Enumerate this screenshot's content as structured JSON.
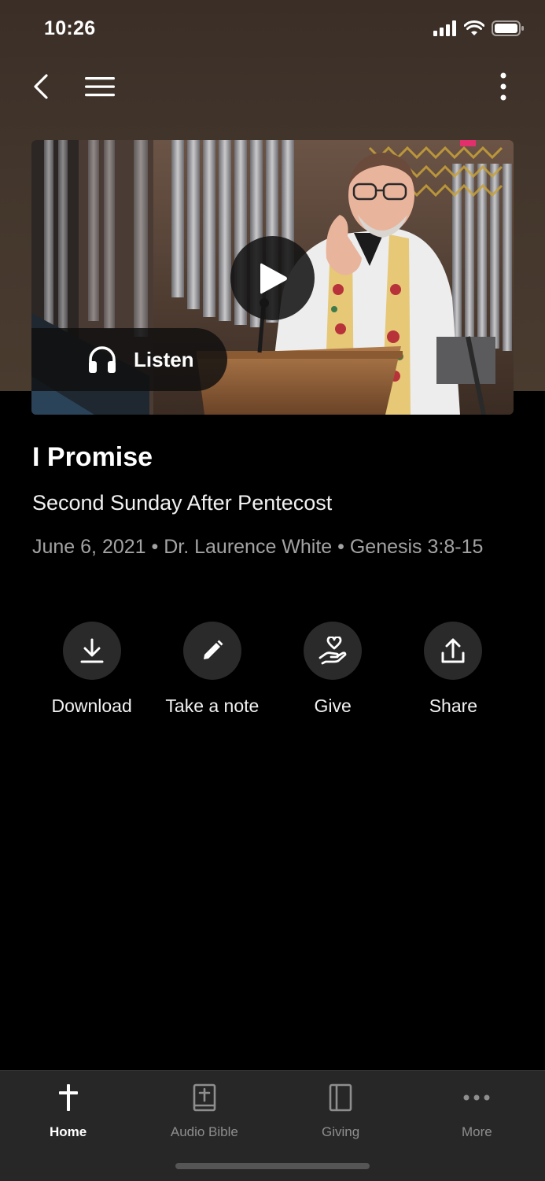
{
  "status_bar": {
    "time": "10:26"
  },
  "nav": {
    "back_icon": "chevron-left-icon",
    "menu_icon": "hamburger-menu-icon",
    "more_icon": "vertical-dots-icon"
  },
  "media": {
    "listen_label": "Listen",
    "play_icon": "play-icon",
    "listen_icon": "headphones-icon"
  },
  "sermon": {
    "title": "I Promise",
    "subtitle": "Second Sunday After Pentecost",
    "meta": "June 6, 2021 • Dr. Laurence White • Genesis 3:8-15"
  },
  "actions": [
    {
      "label": "Download",
      "icon": "download-icon"
    },
    {
      "label": "Take a note",
      "icon": "pencil-icon"
    },
    {
      "label": "Give",
      "icon": "heart-hand-icon"
    },
    {
      "label": "Share",
      "icon": "share-icon"
    }
  ],
  "tab_bar": {
    "tabs": [
      {
        "label": "Home",
        "icon": "cross-icon",
        "active": true
      },
      {
        "label": "Audio Bible",
        "icon": "bible-icon",
        "active": false
      },
      {
        "label": "Giving",
        "icon": "book-icon",
        "active": false
      },
      {
        "label": "More",
        "icon": "horizontal-dots-icon",
        "active": false
      }
    ]
  },
  "colors": {
    "background": "#000000",
    "header_brown": "#43362c",
    "tab_bar": "#272727",
    "action_circle": "#2a2a2a",
    "muted_text": "#a3a3a3"
  }
}
